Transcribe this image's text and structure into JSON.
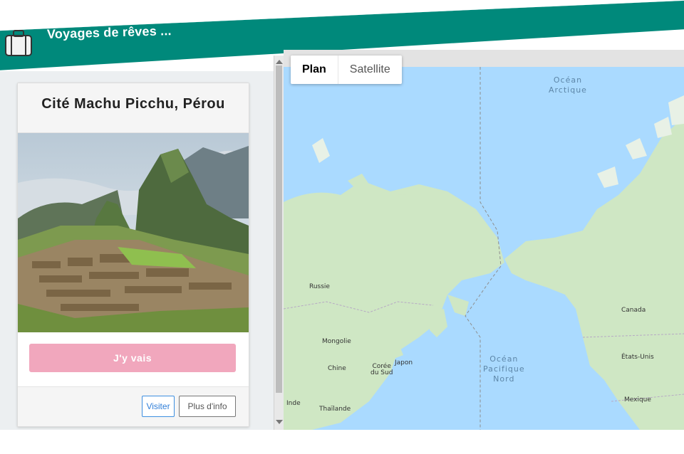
{
  "header": {
    "title": "Voyages de rêves ...",
    "color": "#00897b",
    "logo_icon": "suitcase-icon"
  },
  "card": {
    "title": "Cité Machu Picchu, Pérou",
    "photo_icon": "mountain-photo",
    "primary_button": "J'y vais",
    "primary_button_color": "#f1a7bd",
    "visit_button": "Visiter",
    "more_button": "Plus d'info"
  },
  "map": {
    "tabs": [
      {
        "label": "Plan",
        "active": true
      },
      {
        "label": "Satellite",
        "active": false
      }
    ],
    "water_color": "#aadaff",
    "land_color": "#cfe7c4",
    "ocean_labels": {
      "arctic": "Océan\nArctique",
      "pacific": "Océan\nPacifique\nNord"
    },
    "place_labels": {
      "russia": "Russie",
      "mongolia": "Mongolie",
      "china": "Chine",
      "south_korea": "Corée\ndu Sud",
      "japan": "Japon",
      "india": "Inde",
      "thailand": "Thaïlande",
      "canada": "Canada",
      "usa": "États-Unis",
      "mexico": "Mexique"
    }
  }
}
